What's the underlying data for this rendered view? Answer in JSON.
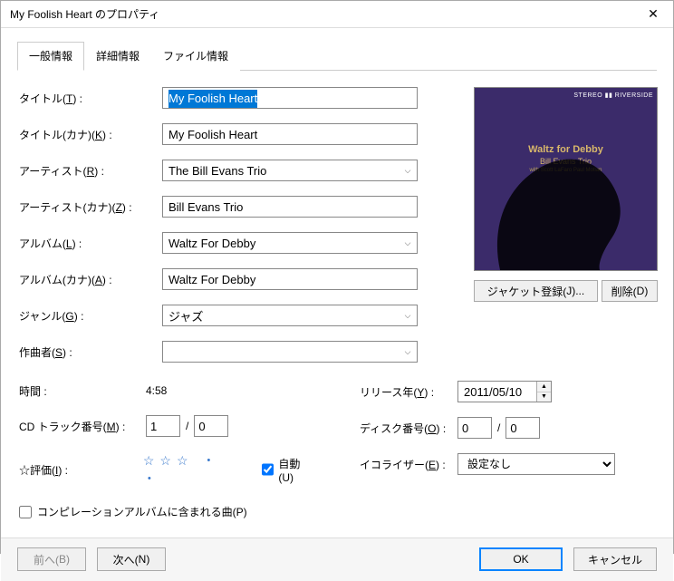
{
  "window": {
    "title": "My Foolish Heart のプロパティ"
  },
  "tabs": [
    {
      "label": "一般情報"
    },
    {
      "label": "詳細情報"
    },
    {
      "label": "ファイル情報"
    }
  ],
  "labels": {
    "title": "タイトル(",
    "title_u": "T",
    "title_end": ") :",
    "title_kana": "タイトル(カナ)(",
    "title_kana_u": "K",
    "title_kana_end": ") :",
    "artist": "アーティスト(",
    "artist_u": "R",
    "artist_end": ") :",
    "artist_kana": "アーティスト(カナ)(",
    "artist_kana_u": "Z",
    "artist_kana_end": ") :",
    "album": "アルバム(",
    "album_u": "L",
    "album_end": ") :",
    "album_kana": "アルバム(カナ)(",
    "album_kana_u": "A",
    "album_kana_end": ") :",
    "genre": "ジャンル(",
    "genre_u": "G",
    "genre_end": ") :",
    "composer": "作曲者(",
    "composer_u": "S",
    "composer_end": ") :",
    "time": "時間 :",
    "cdtrack": "CD トラック番号(",
    "cdtrack_u": "M",
    "cdtrack_end": ") :",
    "rating": "☆評価(",
    "rating_u": "I",
    "rating_end": ") :",
    "release": "リリース年(",
    "release_u": "Y",
    "release_end": ") :",
    "disc": "ディスク番号(",
    "disc_u": "O",
    "disc_end": ") :",
    "eq": "イコライザー(",
    "eq_u": "E",
    "eq_end": ") :",
    "auto": "自動(",
    "auto_u": "U",
    "auto_end": ")",
    "compile": "コンピレーションアルバムに含まれる曲(",
    "compile_u": "P",
    "compile_end": ")",
    "slash": " / "
  },
  "values": {
    "title": "My Foolish Heart",
    "title_kana": "My Foolish Heart",
    "artist": "The Bill Evans Trio",
    "artist_kana": "Bill Evans Trio",
    "album": "Waltz For Debby",
    "album_kana": "Waltz For Debby",
    "genre": "ジャズ",
    "composer": "",
    "time": "4:58",
    "cdtrack_num": "1",
    "cdtrack_of": "0",
    "release": "2011/05/10",
    "disc_num": "0",
    "disc_of": "0",
    "rating_display": "☆☆☆ ・ ・",
    "eq": "設定なし",
    "auto_checked": true,
    "compile_checked": false
  },
  "cover": {
    "brand": "STEREO ▮▮ RIVERSIDE",
    "line1": "Waltz for Debby",
    "line2": "Bill Evans Trio",
    "line3": "with Scott LaFaro Paul Motian"
  },
  "buttons": {
    "cover_reg": "ジャケット登録(",
    "cover_reg_u": "J",
    "cover_reg_end": ")...",
    "cover_del": "削除(",
    "cover_del_u": "D",
    "cover_del_end": ")",
    "prev": "前へ(",
    "prev_u": "B",
    "prev_end": ")",
    "next": "次へ(",
    "next_u": "N",
    "next_end": ")",
    "ok": "OK",
    "cancel": "キャンセル"
  }
}
